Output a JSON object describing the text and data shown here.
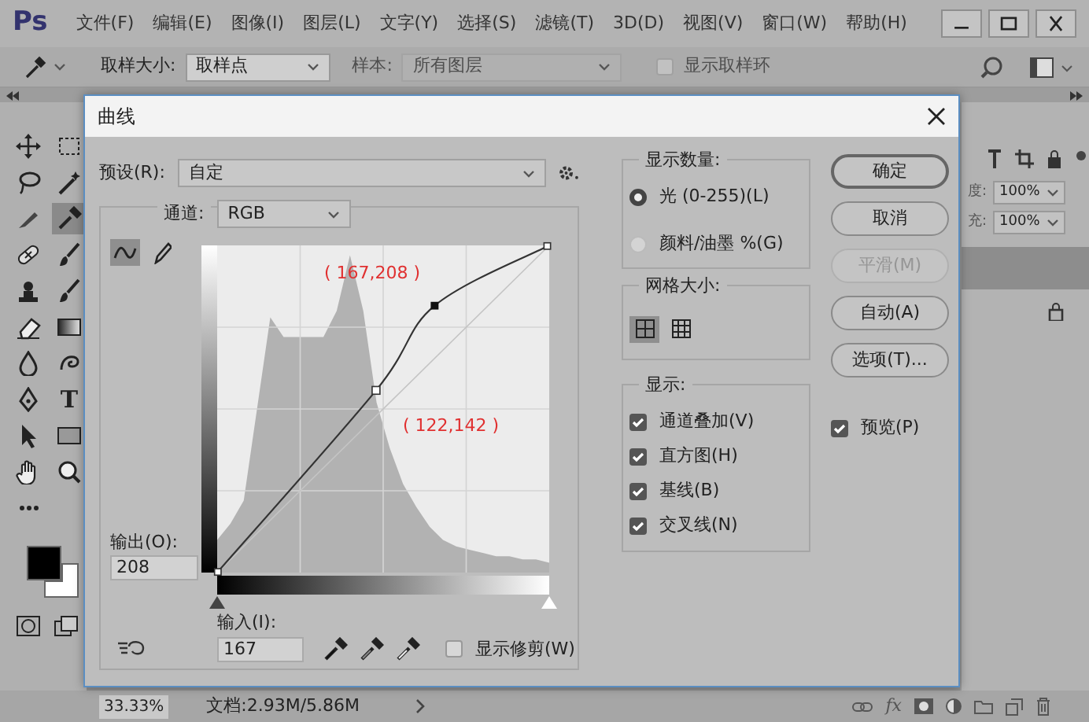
{
  "app": {
    "logo": "Ps",
    "menu": [
      "文件(F)",
      "编辑(E)",
      "图像(I)",
      "图层(L)",
      "文字(Y)",
      "选择(S)",
      "滤镜(T)",
      "3D(D)",
      "视图(V)",
      "窗口(W)",
      "帮助(H)"
    ]
  },
  "options_bar": {
    "sample_size_label": "取样大小:",
    "sample_size_value": "取样点",
    "sample_label": "样本:",
    "sample_value": "所有图层",
    "sample_disabled": true,
    "ring": {
      "label": "显示取样环",
      "checked": false,
      "disabled": true
    }
  },
  "tools": [
    {
      "kind": "move",
      "selected": false
    },
    {
      "kind": "marquee",
      "selected": false
    },
    {
      "kind": "lasso",
      "selected": false
    },
    {
      "kind": "wand",
      "selected": false
    },
    {
      "kind": "knife",
      "selected": false
    },
    {
      "kind": "dropper",
      "selected": true
    },
    {
      "kind": "healing",
      "selected": false
    },
    {
      "kind": "brush",
      "selected": false
    },
    {
      "kind": "stamp",
      "selected": false
    },
    {
      "kind": "brush",
      "selected": false
    },
    {
      "kind": "eraser",
      "selected": false
    },
    {
      "kind": "gradient",
      "selected": false
    },
    {
      "kind": "drop",
      "selected": false
    },
    {
      "kind": "smudge",
      "selected": false
    },
    {
      "kind": "pen",
      "selected": false
    },
    {
      "kind": "type",
      "label": "T",
      "selected": false
    },
    {
      "kind": "cursor",
      "selected": false
    },
    {
      "kind": "rectangle",
      "selected": false
    },
    {
      "kind": "hand",
      "selected": false
    },
    {
      "kind": "zoom",
      "selected": false
    },
    {
      "kind": "more",
      "selected": false
    }
  ],
  "swatches": [
    {
      "kind": "foreground",
      "color": "#000000"
    },
    {
      "kind": "background",
      "color": "#ffffff"
    }
  ],
  "layers_panel": {
    "opacity_label": "度:",
    "opacity_value": "100%",
    "fill_label": "充:",
    "fill_value": "100%",
    "layers": [
      {
        "selected": true,
        "locked": false
      },
      {
        "selected": false,
        "locked": true
      }
    ],
    "footer_fx": "fx"
  },
  "status_bar": {
    "zoom": "33.33%",
    "doc": "文档:2.93M/5.86M"
  },
  "dialog": {
    "title": "曲线",
    "preset_label": "预设(R):",
    "preset_value": "自定",
    "channel_label": "通道:",
    "channel_value": "RGB",
    "edit_modes": [
      {
        "kind": "curve",
        "selected": true
      },
      {
        "kind": "pencil",
        "selected": false
      }
    ],
    "point_labels": [
      "( 167,208 )",
      "( 122,142 )"
    ],
    "output_label": "输出(O):",
    "output_value": "208",
    "input_sliders": [
      {
        "level": 0
      },
      {
        "level": 1
      }
    ],
    "input_label": "输入(I):",
    "input_value": "167",
    "show_clipping": {
      "label": "显示修剪(W)",
      "checked": false
    },
    "display_amount": {
      "title": "显示数量:",
      "options": [
        {
          "label": "光 (0-255)(L)",
          "selected": true
        },
        {
          "label": "颜料/油墨 %(G)",
          "selected": false
        }
      ]
    },
    "grid_size": {
      "title": "网格大小:",
      "options": [
        {
          "kind": "coarse",
          "selected": true
        },
        {
          "kind": "fine",
          "selected": false
        }
      ]
    },
    "show": {
      "title": "显示:",
      "options": [
        {
          "label": "通道叠加(V)",
          "checked": true
        },
        {
          "label": "直方图(H)",
          "checked": true
        },
        {
          "label": "基线(B)",
          "checked": true
        },
        {
          "label": "交叉线(N)",
          "checked": true
        }
      ]
    },
    "buttons": [
      {
        "label": "确定",
        "default": true,
        "disabled": false
      },
      {
        "label": "取消",
        "default": false,
        "disabled": false
      },
      {
        "label": "平滑(M)",
        "default": false,
        "disabled": true
      },
      {
        "label": "自动(A)",
        "default": false,
        "disabled": false
      },
      {
        "label": "选项(T)...",
        "default": false,
        "disabled": false
      }
    ],
    "preview": {
      "label": "预览(P)",
      "checked": true
    }
  }
}
